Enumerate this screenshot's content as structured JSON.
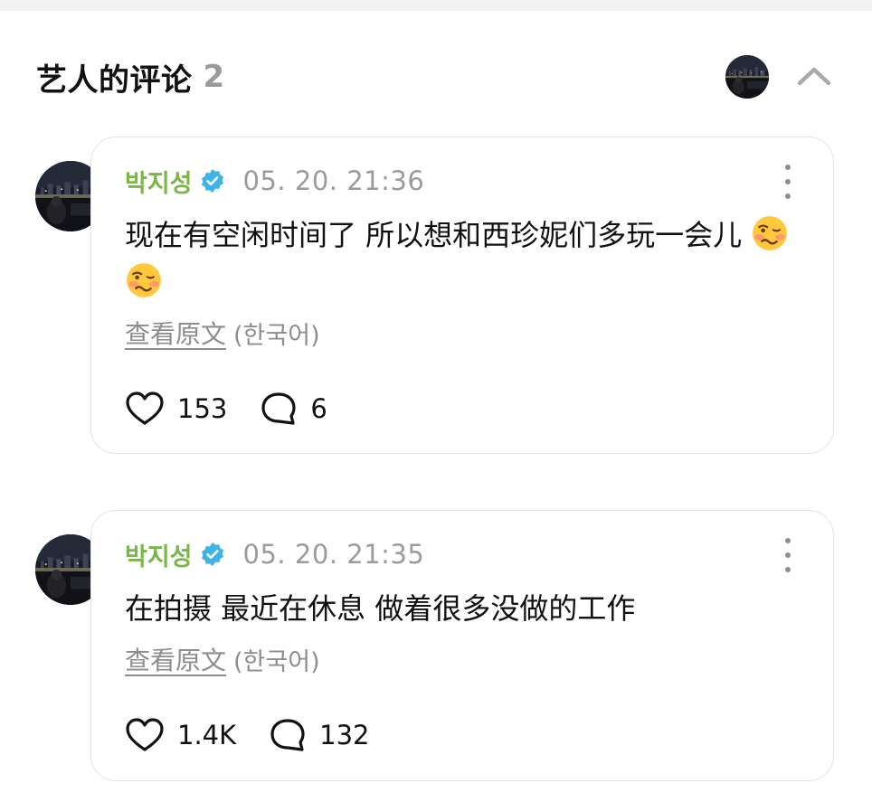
{
  "section": {
    "title": "艺人的评论",
    "count": "2"
  },
  "colors": {
    "author": "#7ab648",
    "verified": "#3cb4e5",
    "muted": "#9b9b9b"
  },
  "comments": [
    {
      "author": "박지성",
      "timestamp": "05. 20. 21:36",
      "text": "现在有空闲时间了 所以想和西珍妮们多玩一会儿",
      "emojis": [
        "woozy-face-emoji",
        "woozy-face-emoji"
      ],
      "view_original": "查看原文",
      "language": "(한국어)",
      "likes": "153",
      "replies": "6"
    },
    {
      "author": "박지성",
      "timestamp": "05. 20. 21:35",
      "text": "在拍摄 最近在休息 做着很多没做的工作",
      "emojis": [],
      "view_original": "查看原文",
      "language": "(한국어)",
      "likes": "1.4K",
      "replies": "132"
    }
  ],
  "icons": {
    "verified": "verified-badge-icon",
    "more": "more-vertical-icon",
    "like": "heart-icon",
    "reply": "comment-bubble-icon",
    "collapse": "chevron-up-icon"
  }
}
